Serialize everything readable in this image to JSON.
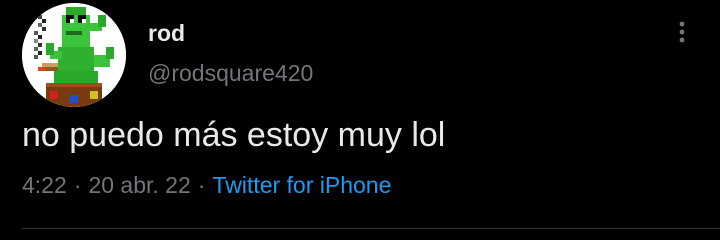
{
  "tweet": {
    "author": {
      "display_name": "rod",
      "handle": "@rodsquare420",
      "avatar_icon": "pixel-art-green-cactus-smoking-icon"
    },
    "text": "no puedo más estoy muy lol",
    "meta": {
      "time": "4:22",
      "separator": "·",
      "date": "20 abr. 22",
      "source": "Twitter for iPhone"
    },
    "more_icon": "more-vertical-icon"
  },
  "colors": {
    "background": "#000000",
    "primary_text": "#e7e9ea",
    "secondary_text": "#71767b",
    "link": "#1d9bf0",
    "divider": "#2f3336"
  }
}
